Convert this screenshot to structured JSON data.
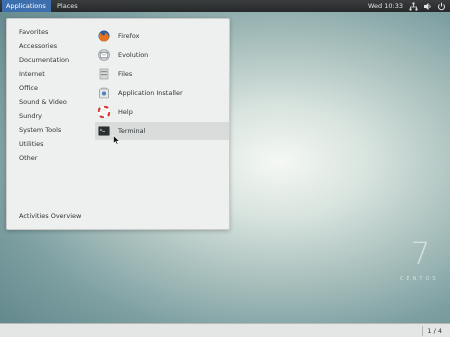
{
  "topbar": {
    "applications_label": "Applications",
    "places_label": "Places",
    "clock": "Wed 10:33",
    "icons": [
      "network-icon",
      "volume-icon",
      "power-icon"
    ]
  },
  "menu": {
    "categories": [
      "Favorites",
      "Accessories",
      "Documentation",
      "Internet",
      "Office",
      "Sound & Video",
      "Sundry",
      "System Tools",
      "Utilities",
      "Other"
    ],
    "selected_category": "Favorites",
    "apps": [
      {
        "label": "Firefox",
        "icon": "firefox-icon"
      },
      {
        "label": "Evolution",
        "icon": "evolution-icon"
      },
      {
        "label": "Files",
        "icon": "files-icon"
      },
      {
        "label": "Application Installer",
        "icon": "installer-icon"
      },
      {
        "label": "Help",
        "icon": "help-icon"
      },
      {
        "label": "Terminal",
        "icon": "terminal-icon"
      }
    ],
    "highlighted_app": "Terminal",
    "activities_overview": "Activities Overview"
  },
  "watermark": {
    "number": "7",
    "text": "CENTOS"
  },
  "bottombar": {
    "workspace": "1 / 4"
  }
}
